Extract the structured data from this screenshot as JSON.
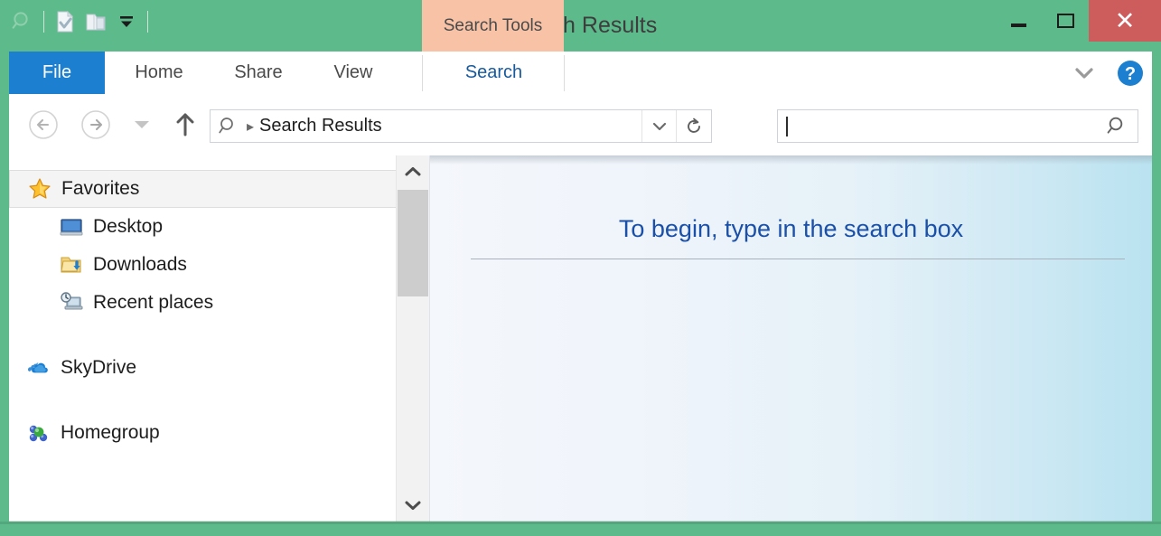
{
  "window": {
    "title": "Search Results",
    "frame_color": "#5cba8b",
    "contextual_tool_label": "Search Tools",
    "contextual_tool_color": "#f7c2a6",
    "controls": {
      "minimize_label": "Minimize",
      "maximize_label": "Maximize",
      "close_label": "Close",
      "close_color": "#cd5c5c"
    }
  },
  "quick_access": {
    "items": [
      {
        "name": "window-menu-icon",
        "label": "Search Results menu"
      },
      {
        "name": "properties-icon",
        "label": "Properties"
      },
      {
        "name": "new-folder-icon",
        "label": "New folder"
      },
      {
        "name": "customize-dropdown-icon",
        "label": "Customize Quick Access Toolbar"
      }
    ]
  },
  "ribbon": {
    "tabs": [
      {
        "label": "File",
        "active": false,
        "style": "file",
        "color": "#1c7fd0"
      },
      {
        "label": "Home",
        "active": false,
        "style": "normal"
      },
      {
        "label": "Share",
        "active": false,
        "style": "normal"
      },
      {
        "label": "View",
        "active": false,
        "style": "normal"
      },
      {
        "label": "Search",
        "active": true,
        "style": "contextual",
        "color": "#17599c"
      }
    ],
    "collapse_label": "Minimize the Ribbon",
    "help_label": "Help"
  },
  "navigation": {
    "back_label": "Back",
    "forward_label": "Forward",
    "recent_label": "Recent locations",
    "up_label": "Up one level",
    "address": {
      "icon": "search-icon",
      "separator": "▸",
      "crumb": "Search Results",
      "dropdown_label": "Previous locations",
      "refresh_label": "Refresh"
    },
    "search": {
      "value": "",
      "placeholder": "",
      "icon": "search-icon",
      "focused": true
    }
  },
  "nav_pane": {
    "groups": [
      {
        "root": {
          "label": "Favorites",
          "icon": "star-icon",
          "selected": true
        },
        "children": [
          {
            "label": "Desktop",
            "icon": "desktop-icon"
          },
          {
            "label": "Downloads",
            "icon": "downloads-folder-icon"
          },
          {
            "label": "Recent places",
            "icon": "recent-places-icon"
          }
        ]
      },
      {
        "root": {
          "label": "SkyDrive",
          "icon": "cloud-icon",
          "selected": false
        },
        "children": []
      },
      {
        "root": {
          "label": "Homegroup",
          "icon": "homegroup-icon",
          "selected": false
        },
        "children": []
      }
    ],
    "scrollbar": {
      "up_label": "Scroll up",
      "down_label": "Scroll down",
      "thumb_label": "Vertical scroll thumb"
    }
  },
  "content": {
    "empty_message": "To begin, type in the search box",
    "message_color": "#1b50a8",
    "background_from": "#f4f7fb",
    "background_to": "#b9e2f0"
  }
}
